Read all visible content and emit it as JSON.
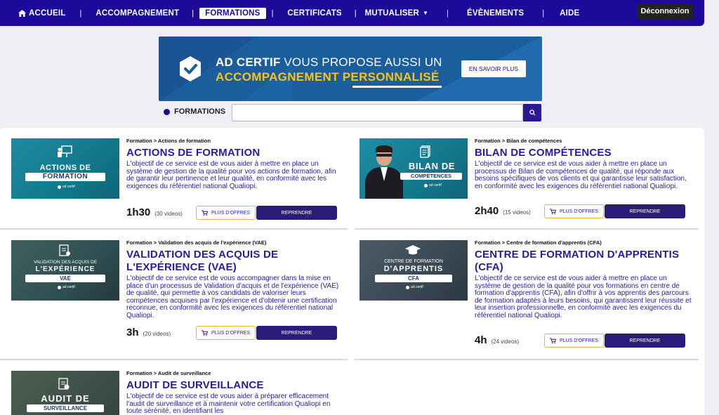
{
  "nav": {
    "items": [
      {
        "label": "ACCUEIL"
      },
      {
        "label": "ACCOMPAGNEMENT"
      },
      {
        "label": "FORMATIONS"
      },
      {
        "label": "CERTIFICATS"
      },
      {
        "label": "MUTUALISER"
      },
      {
        "label": "ÉVÈNEMENTS"
      },
      {
        "label": "AIDE"
      }
    ],
    "separator": "|",
    "logout_label": "Déconnexion"
  },
  "banner": {
    "brand": "AD CERTIF",
    "line1_rest": " VOUS PROPOSE AUSSI UN",
    "line2": "ACCOMPAGNEMENT PERSONNALISÉ",
    "button_label": "EN SAVOIR PLUS"
  },
  "search": {
    "label": "FORMATIONS",
    "value": ""
  },
  "courses": [
    {
      "breadcrumb": "Formation > Actions de formation",
      "title": "ACTIONS DE FORMATION",
      "description": "L'objectif de ce service est de vous aider à mettre en place un système de gestion de la qualité pour vos actions de formation, afin de garantir leur pertinence et leur qualité, en conformité avec les exigences du référentiel national Qualiopi.",
      "duration": "1h30",
      "videos": "(30 videos)",
      "thumb_line1": "ACTIONS DE",
      "thumb_line2": "FORMATION",
      "thumb_logo": "ad certif",
      "offers_label": "PLUS D'OFFRES",
      "resume_label": "REPRENDRE"
    },
    {
      "breadcrumb": "Formation > Bilan de compétences",
      "title": "BILAN DE COMPÉTENCES",
      "description": "L'objectif de ce service est de vous aider à mettre en place un processus de Bilan de compétences de qualité, qui réponde aux besoins spécifiques de vos clients et qui garantisse leur satisfaction, en conformité avec les exigences du référentiel national Qualiopi.",
      "duration": "2h40",
      "videos": "(15 videos)",
      "thumb_line1": "BILAN DE",
      "thumb_line2": "COMPÉTENCES",
      "thumb_logo": "ad certif",
      "offers_label": "PLUS D'OFFRES",
      "resume_label": "REPRENDRE"
    },
    {
      "breadcrumb": "Formation > Validation des acquis de l'expérience (VAE)",
      "title": "VALIDATION DES ACQUIS DE L'EXPÉRIENCE (VAE)",
      "description": "L'objectif de ce service est de vous accompagner dans la mise en place d'un processus de Validation d'acquis et de l'expérience (VAE) de qualité, qui permette à vos candidats de valoriser leurs compétences acquises par l'expérience et d'obtenir une certification reconnue, en conformité avec les exigences du référentiel national Qualiopi.",
      "duration": "3h",
      "videos": "(20 videos)",
      "thumb_line0": "VALIDATION DES ACQUIS DE",
      "thumb_line1": "L'EXPÉRIENCE",
      "thumb_line2": "VAE",
      "thumb_logo": "ad certif",
      "offers_label": "PLUS D'OFFRES",
      "resume_label": "REPRENDRE"
    },
    {
      "breadcrumb": "Formation > Centre de formation d'apprentis (CFA)",
      "title": "CENTRE DE FORMATION D'APPRENTIS (CFA)",
      "description": "L'objectif de ce service est de vous aider à mettre en place un système de gestion de la qualité pour vos formations en centre de formation d'apprentis (CFA), afin d'offrir à vos apprentis des parcours de formation adaptés à leurs besoins, qui garantissent leur réussite et leur insertion professionnelle, en conformité avec les exigences du référentiel national Qualiopi.",
      "duration": "4h",
      "videos": "(24 videos)",
      "thumb_line0": "CENTRE DE FORMATION",
      "thumb_line1": "D'APPRENTIS",
      "thumb_line2": "CFA",
      "thumb_logo": "ad certif",
      "offers_label": "PLUS D'OFFRES",
      "resume_label": "REPRENDRE"
    },
    {
      "breadcrumb": "Formation > Audit de surveillance",
      "title": "AUDIT DE SURVEILLANCE",
      "description": "L'objectif de ce service est de vous aider à préparer efficacement l'audit de surveillance et à maintenir votre certification Qualiopi en toute sérénité, en identifiant les",
      "thumb_line1": "AUDIT DE",
      "thumb_line2": "SURVEILLANCE"
    }
  ],
  "colors": {
    "nav": "#1e0a9a",
    "title": "#2a1a9e",
    "banner": "#1b5e9e",
    "accent_yellow": "#f7c318",
    "resume_button": "#2b1a7a"
  }
}
